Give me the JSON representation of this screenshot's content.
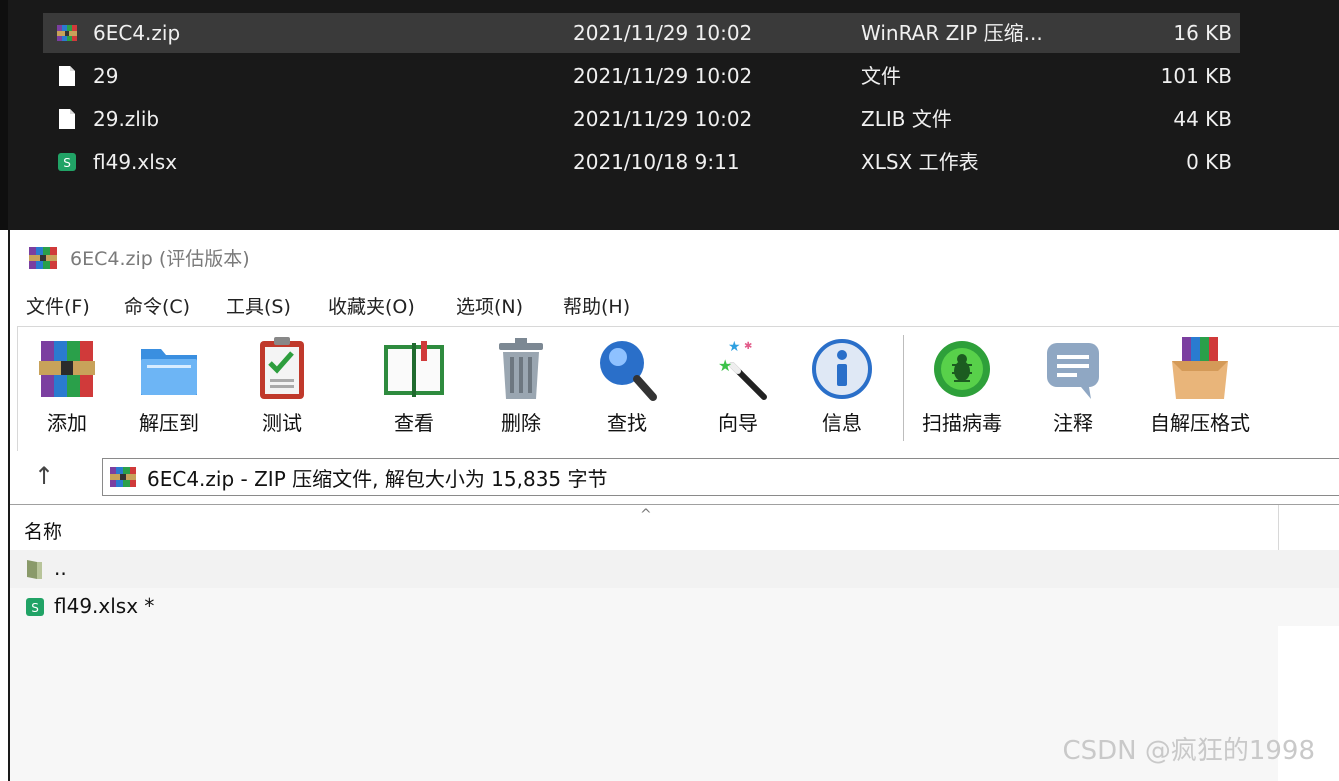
{
  "explorer": {
    "files": [
      {
        "name": "6EC4.zip",
        "date": "2021/11/29 10:02",
        "type": "WinRAR ZIP 压缩...",
        "size": "16 KB",
        "icon": "winrar-archive-icon",
        "selected": true
      },
      {
        "name": "29",
        "date": "2021/11/29 10:02",
        "type": "文件",
        "size": "101 KB",
        "icon": "blank-file-icon"
      },
      {
        "name": "29.zlib",
        "date": "2021/11/29 10:02",
        "type": "ZLIB 文件",
        "size": "44 KB",
        "icon": "blank-file-icon"
      },
      {
        "name": "fl49.xlsx",
        "date": "2021/10/18 9:11",
        "type": "XLSX 工作表",
        "size": "0 KB",
        "icon": "xlsx-sheet-icon"
      }
    ]
  },
  "winrar": {
    "title": "6EC4.zip (评估版本)",
    "menu": [
      "文件(F)",
      "命令(C)",
      "工具(S)",
      "收藏夹(O)",
      "选项(N)",
      "帮助(H)"
    ],
    "toolbar": [
      {
        "label": "添加",
        "icon": "add-archive-icon"
      },
      {
        "label": "解压到",
        "icon": "extract-folder-icon"
      },
      {
        "label": "测试",
        "icon": "test-clipboard-icon"
      },
      {
        "label": "查看",
        "icon": "view-book-icon"
      },
      {
        "label": "删除",
        "icon": "trash-icon"
      },
      {
        "label": "查找",
        "icon": "magnifier-icon"
      },
      {
        "label": "向导",
        "icon": "wizard-wand-icon"
      },
      {
        "label": "信息",
        "icon": "info-icon"
      },
      {
        "label": "扫描病毒",
        "icon": "virus-scan-icon"
      },
      {
        "label": "注释",
        "icon": "comment-icon"
      },
      {
        "label": "自解压格式",
        "icon": "sfx-box-icon"
      }
    ],
    "address": {
      "up_glyph": "↑",
      "path": "6EC4.zip - ZIP 压缩文件, 解包大小为 15,835 字节"
    },
    "list": {
      "column_name": "名称",
      "sort_glyph": "^",
      "rows": [
        {
          "name": "..",
          "icon": "parent-folder-icon"
        },
        {
          "name": "fl49.xlsx *",
          "icon": "xlsx-sheet-icon"
        }
      ]
    }
  },
  "watermark": "CSDN @疯狂的1998",
  "colors": {
    "explorer_bg": "#191919",
    "explorer_selected": "#3a3a3a",
    "excel_green": "#21a366"
  }
}
